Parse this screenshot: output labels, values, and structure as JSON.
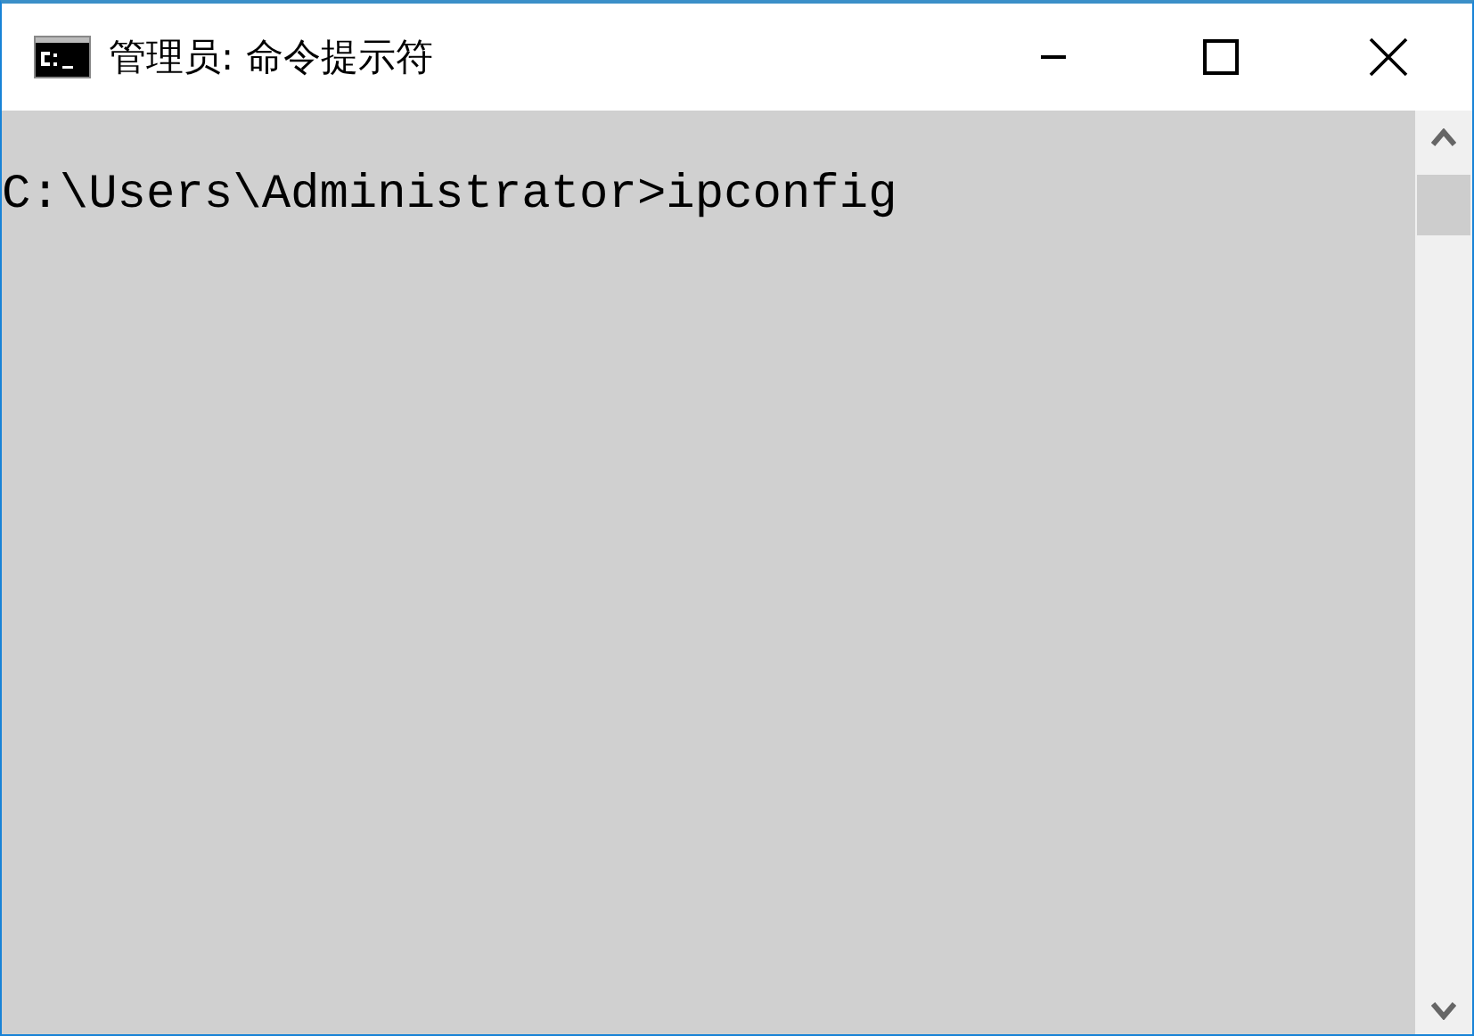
{
  "window": {
    "title": "管理员: 命令提示符"
  },
  "console": {
    "lines": [
      "C:\\Users\\Administrator>ipconfig"
    ]
  }
}
